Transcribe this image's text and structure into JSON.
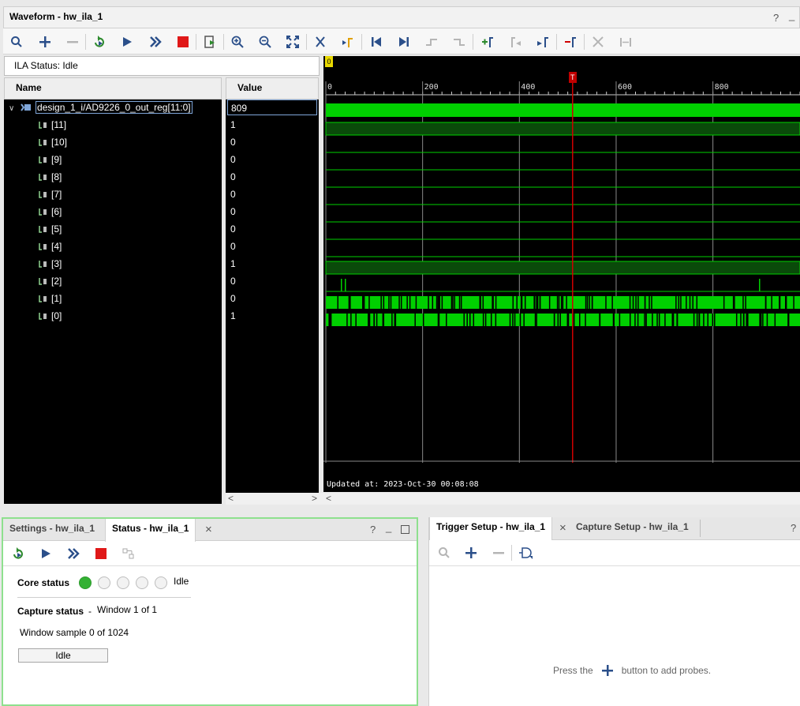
{
  "waveform": {
    "title": "Waveform - hw_ila_1",
    "help": "?",
    "minimize": "_",
    "ila_status_label": "ILA Status:",
    "ila_status_value": "Idle",
    "name_header": "Name",
    "value_header": "Value",
    "bus": {
      "name": "design_1_i/AD9226_0_out_reg[11:0]",
      "value": "809"
    },
    "bits": [
      {
        "name": "[11]",
        "value": "1"
      },
      {
        "name": "[10]",
        "value": "0"
      },
      {
        "name": "[9]",
        "value": "0"
      },
      {
        "name": "[8]",
        "value": "0"
      },
      {
        "name": "[7]",
        "value": "0"
      },
      {
        "name": "[6]",
        "value": "0"
      },
      {
        "name": "[5]",
        "value": "0"
      },
      {
        "name": "[4]",
        "value": "0"
      },
      {
        "name": "[3]",
        "value": "1"
      },
      {
        "name": "[2]",
        "value": "0"
      },
      {
        "name": "[1]",
        "value": "0"
      },
      {
        "name": "[0]",
        "value": "1"
      }
    ],
    "ruler_labels": [
      "0",
      "200",
      "400",
      "600",
      "800"
    ],
    "ruler_values": [
      0,
      200,
      400,
      600,
      800
    ],
    "ruler_max": 980,
    "trigger_marker_label": "T",
    "trigger_value": 510,
    "origin_marker_label": "0",
    "updated_text": "Updated at: 2023-Oct-30 00:08:08",
    "trace_color": "#00d000",
    "trigger_color": "#d00000"
  },
  "status_panel": {
    "tab_settings": "Settings - hw_ila_1",
    "tab_status": "Status - hw_ila_1",
    "close": "×",
    "help": "?",
    "minimize": "_",
    "core_status_label": "Core status",
    "core_status_value": "Idle",
    "capture_status_label": "Capture status",
    "capture_status_sep": "-",
    "capture_status_value": "Window 1 of 1",
    "window_sample": "Window sample 0 of 1024",
    "idle_button": "Idle"
  },
  "trigger_panel": {
    "tab_trigger": "Trigger Setup - hw_ila_1",
    "tab_capture": "Capture Setup - hw_ila_1",
    "close": "×",
    "help": "?",
    "hint_before": "Press the",
    "hint_after": "button to add probes."
  }
}
